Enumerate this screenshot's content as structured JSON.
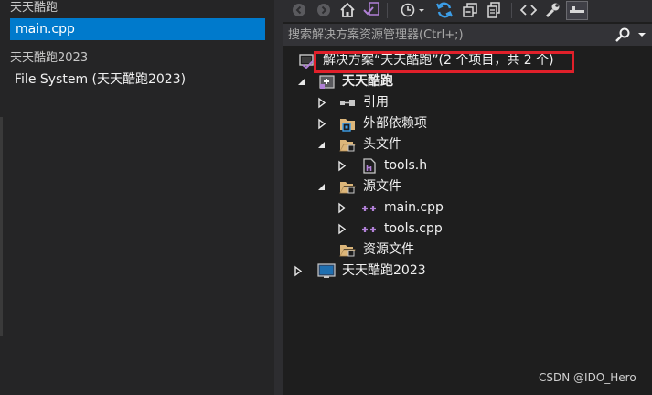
{
  "left_panel": {
    "group1_title": "天天酷跑",
    "open_file": "main.cpp",
    "group2_title": "天天酷跑2023",
    "group2_item": "File System (天天酷跑2023)"
  },
  "toolbar": {
    "icons": [
      "back-icon",
      "forward-icon",
      "home-icon",
      "vs-switch-icon",
      "history-icon",
      "sync-icon",
      "collapse-all-icon",
      "show-all-files-icon",
      "view-code-icon",
      "properties-icon",
      "preview-pin-icon"
    ]
  },
  "search": {
    "placeholder": "搜索解决方案资源管理器(Ctrl+;)"
  },
  "tree": {
    "solution_label": "解决方案“天天酷跑”(2 个项目，共 2 个)",
    "project1": "天天酷跑",
    "references": "引用",
    "external_deps": "外部依赖项",
    "header_files": "头文件",
    "tools_h": "tools.h",
    "source_files": "源文件",
    "main_cpp": "main.cpp",
    "tools_cpp": "tools.cpp",
    "resource_files": "资源文件",
    "project2": "天天酷跑2023"
  },
  "watermark": "CSDN @IDO_Hero",
  "colors": {
    "selection": "#007acc",
    "highlight_box": "#e0202a",
    "folder": "#dcb67a",
    "cpp_icon": "#b180d7",
    "sync": "#3c9ee8"
  }
}
